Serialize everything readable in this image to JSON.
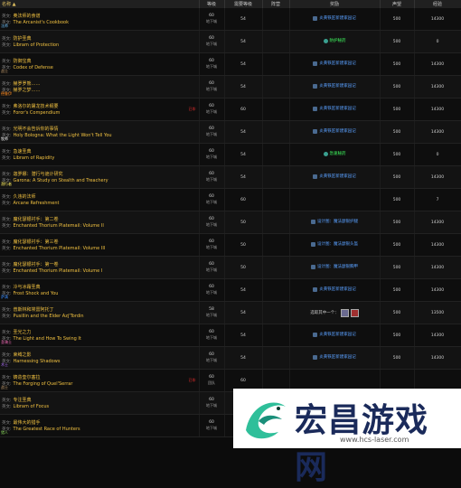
{
  "header": {
    "name": "名称",
    "level": "等级",
    "req_level": "需要等级",
    "side": "阵营",
    "reward": "奖励",
    "rep": "声望",
    "exp": "经验"
  },
  "rows": [
    {
      "lang1": "英文:",
      "zh": "奥法师的食谱",
      "lang2": "英文:",
      "en": "The Arcanist's Cookbook",
      "cls": "法师",
      "cls_color": "#6fc3ff",
      "lvl": "60",
      "lvl_sub": "地下城",
      "req": "54",
      "reward": "炎黄铁匠新建家园记",
      "reward_type": "blue",
      "rep": "500",
      "exp": "14300",
      "warn": ""
    },
    {
      "lang1": "英文:",
      "zh": "防护圣典",
      "lang2": "英文:",
      "en": "Libram of Protection",
      "cls": "",
      "cls_color": "",
      "lvl": "60",
      "lvl_sub": "地下城",
      "req": "54",
      "reward": "防护秘药",
      "reward_type": "green",
      "rep": "500",
      "exp": "0",
      "warn": ""
    },
    {
      "lang1": "英文:",
      "zh": "防御宝典",
      "lang2": "英文:",
      "en": "Codex of Defense",
      "cls": "战士",
      "cls_color": "#c8a070",
      "lvl": "60",
      "lvl_sub": "地下城",
      "req": "54",
      "reward": "炎黄铁匠新建家园记",
      "reward_type": "blue",
      "rep": "500",
      "exp": "14300",
      "warn": ""
    },
    {
      "lang1": "英文:",
      "zh": "赫罗罗熊……",
      "lang2": "英文:",
      "en": "赫罗之梦……",
      "cls": "德鲁伊",
      "cls_color": "#ff8c20",
      "lvl": "60",
      "lvl_sub": "地下城",
      "req": "54",
      "reward": "炎黄铁匠新建家园记",
      "reward_type": "blue",
      "rep": "500",
      "exp": "14300",
      "warn": ""
    },
    {
      "lang1": "英文:",
      "zh": "弗洛尔的屠龙技术纲要",
      "lang2": "英文:",
      "en": "Foror's Compendium",
      "cls": "",
      "cls_color": "",
      "lvl": "60",
      "lvl_sub": "地下城",
      "req": "60",
      "reward": "炎黄铁匠新建家园记",
      "reward_type": "blue",
      "rep": "500",
      "exp": "14300",
      "warn": "已毕"
    },
    {
      "lang1": "英文:",
      "zh": "光明不会告诉你的事情",
      "lang2": "英文:",
      "en": "Holy Bologna:  What the Light Won't Tell You",
      "cls": "牧师",
      "cls_color": "#ffffff",
      "lvl": "60",
      "lvl_sub": "地下城",
      "req": "54",
      "reward": "炎黄铁匠新建家园记",
      "reward_type": "blue",
      "rep": "500",
      "exp": "14300",
      "warn": ""
    },
    {
      "lang1": "英文:",
      "zh": "急速圣典",
      "lang2": "英文:",
      "en": "Libram of Rapidity",
      "cls": "",
      "cls_color": "",
      "lvl": "60",
      "lvl_sub": "地下城",
      "req": "54",
      "reward": "急速秘药",
      "reward_type": "green",
      "rep": "500",
      "exp": "0",
      "warn": ""
    },
    {
      "lang1": "英文:",
      "zh": "迦罗娜：潜行与诡计研究",
      "lang2": "英文:",
      "en": "Garona:  A Study on Stealth and Treachery",
      "cls": "潜行者",
      "cls_color": "#fff060",
      "lvl": "60",
      "lvl_sub": "地下城",
      "req": "54",
      "reward": "炎黄铁匠新建家园记",
      "reward_type": "blue",
      "rep": "500",
      "exp": "14300",
      "warn": ""
    },
    {
      "lang1": "英文:",
      "zh": "久违的法师",
      "lang2": "英文:",
      "en": "Arcane Refreshment",
      "cls": "",
      "cls_color": "",
      "lvl": "60",
      "lvl_sub": "地下城",
      "req": "60",
      "reward": "",
      "reward_type": "none",
      "rep": "500",
      "exp": "7",
      "warn": ""
    },
    {
      "lang1": "英文:",
      "zh": "魔化瑟银衬手：第二卷",
      "lang2": "英文:",
      "en": "Enchanted Thorium Platemail:  Volume II",
      "cls": "",
      "cls_color": "",
      "lvl": "60",
      "lvl_sub": "地下城",
      "req": "50",
      "reward": "设计图：魔法瑟银护腿",
      "reward_type": "blue",
      "rep": "500",
      "exp": "14300",
      "warn": ""
    },
    {
      "lang1": "英文:",
      "zh": "魔化瑟银衬手：第三卷",
      "lang2": "英文:",
      "en": "Enchanted Thorium Platemail:  Volume III",
      "cls": "",
      "cls_color": "",
      "lvl": "60",
      "lvl_sub": "地下城",
      "req": "50",
      "reward": "设计图：魔法瑟银头盔",
      "reward_type": "blue",
      "rep": "500",
      "exp": "14300",
      "warn": ""
    },
    {
      "lang1": "英文:",
      "zh": "魔化瑟银衬手：第一卷",
      "lang2": "英文:",
      "en": "Enchanted Thorium Platemail:  Volume I",
      "cls": "",
      "cls_color": "",
      "lvl": "60",
      "lvl_sub": "地下城",
      "req": "50",
      "reward": "设计图：魔法瑟银胸甲",
      "reward_type": "blue",
      "rep": "500",
      "exp": "14300",
      "warn": ""
    },
    {
      "lang1": "英文:",
      "zh": "冷与冰霜圣典",
      "lang2": "英文:",
      "en": "Frost Shock and You",
      "cls": "萨满",
      "cls_color": "#3a8cff",
      "lvl": "60",
      "lvl_sub": "地下城",
      "req": "54",
      "reward": "炎黄铁匠新建家园记",
      "reward_type": "blue",
      "rep": "500",
      "exp": "14300",
      "warn": ""
    },
    {
      "lang1": "英文:",
      "zh": "普斯林和埃雷阿托丁",
      "lang2": "英文:",
      "en": "Pusillin and the Elder Azj'Tordin",
      "cls": "",
      "cls_color": "",
      "lvl": "58",
      "lvl_sub": "地下城",
      "req": "54",
      "reward": "选取其中一个：",
      "reward_type": "mixed",
      "rep": "500",
      "exp": "13500",
      "warn": ""
    },
    {
      "lang1": "英文:",
      "zh": "圣光之力",
      "lang2": "英文:",
      "en": "The Light and How To Swing It",
      "cls": "圣骑士",
      "cls_color": "#ff70c0",
      "lvl": "60",
      "lvl_sub": "地下城",
      "req": "54",
      "reward": "炎黄铁匠新建家园记",
      "reward_type": "blue",
      "rep": "500",
      "exp": "14300",
      "warn": ""
    },
    {
      "lang1": "英文:",
      "zh": "束缚之影",
      "lang2": "英文:",
      "en": "Harnessing Shadows",
      "cls": "术士",
      "cls_color": "#b070ff",
      "lvl": "60",
      "lvl_sub": "地下城",
      "req": "54",
      "reward": "炎黄铁匠新建家园记",
      "reward_type": "blue",
      "rep": "500",
      "exp": "14300",
      "warn": ""
    },
    {
      "lang1": "英文:",
      "zh": "铸造奎尔塞拉",
      "lang2": "英文:",
      "en": "The Forging of Quel'Serrar",
      "cls": "战士",
      "cls_color": "#c8a070",
      "lvl": "60",
      "lvl_sub": "团队",
      "req": "60",
      "reward": "",
      "reward_type": "none",
      "rep": "",
      "exp": "",
      "warn": "已毕"
    },
    {
      "lang1": "英文:",
      "zh": "专注圣典",
      "lang2": "英文:",
      "en": "Libram of Focus",
      "cls": "",
      "cls_color": "",
      "lvl": "60",
      "lvl_sub": "地下城",
      "req": "54",
      "reward": "",
      "reward_type": "none",
      "rep": "",
      "exp": "",
      "warn": ""
    },
    {
      "lang1": "英文:",
      "zh": "最伟大的猎手",
      "lang2": "英文:",
      "en": "The Greatest Race of Hunters",
      "cls": "猎人",
      "cls_color": "#90e060",
      "lvl": "60",
      "lvl_sub": "地下城",
      "req": "54",
      "reward": "",
      "reward_type": "none",
      "rep": "",
      "exp": "",
      "warn": ""
    }
  ],
  "watermark": {
    "text": "宏昌游戏网",
    "url": "www.hcs-laser.com"
  }
}
